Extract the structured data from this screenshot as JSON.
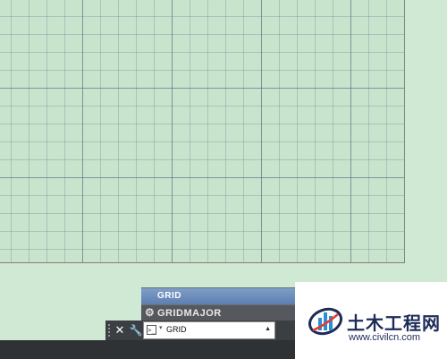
{
  "autocomplete": {
    "items": [
      {
        "label": "GRID",
        "selected": true
      },
      {
        "label": "GRIDMAJOR",
        "icon": "gear-icon",
        "selected": false
      }
    ]
  },
  "command_line": {
    "input_value": "GRID",
    "close_icon": "close-icon",
    "customize_icon": "wrench-icon",
    "prompt_icon": "command-prompt-icon",
    "history_icon": "caret-up-icon"
  },
  "watermark": {
    "brand": "土木工程网",
    "url": "www.civilcn.com"
  },
  "colors": {
    "canvas_bg": "#c9e4cd",
    "grid_line": "#5a6e82",
    "highlight": "#5d7fb0",
    "brand_blue": "#1d2b59"
  }
}
